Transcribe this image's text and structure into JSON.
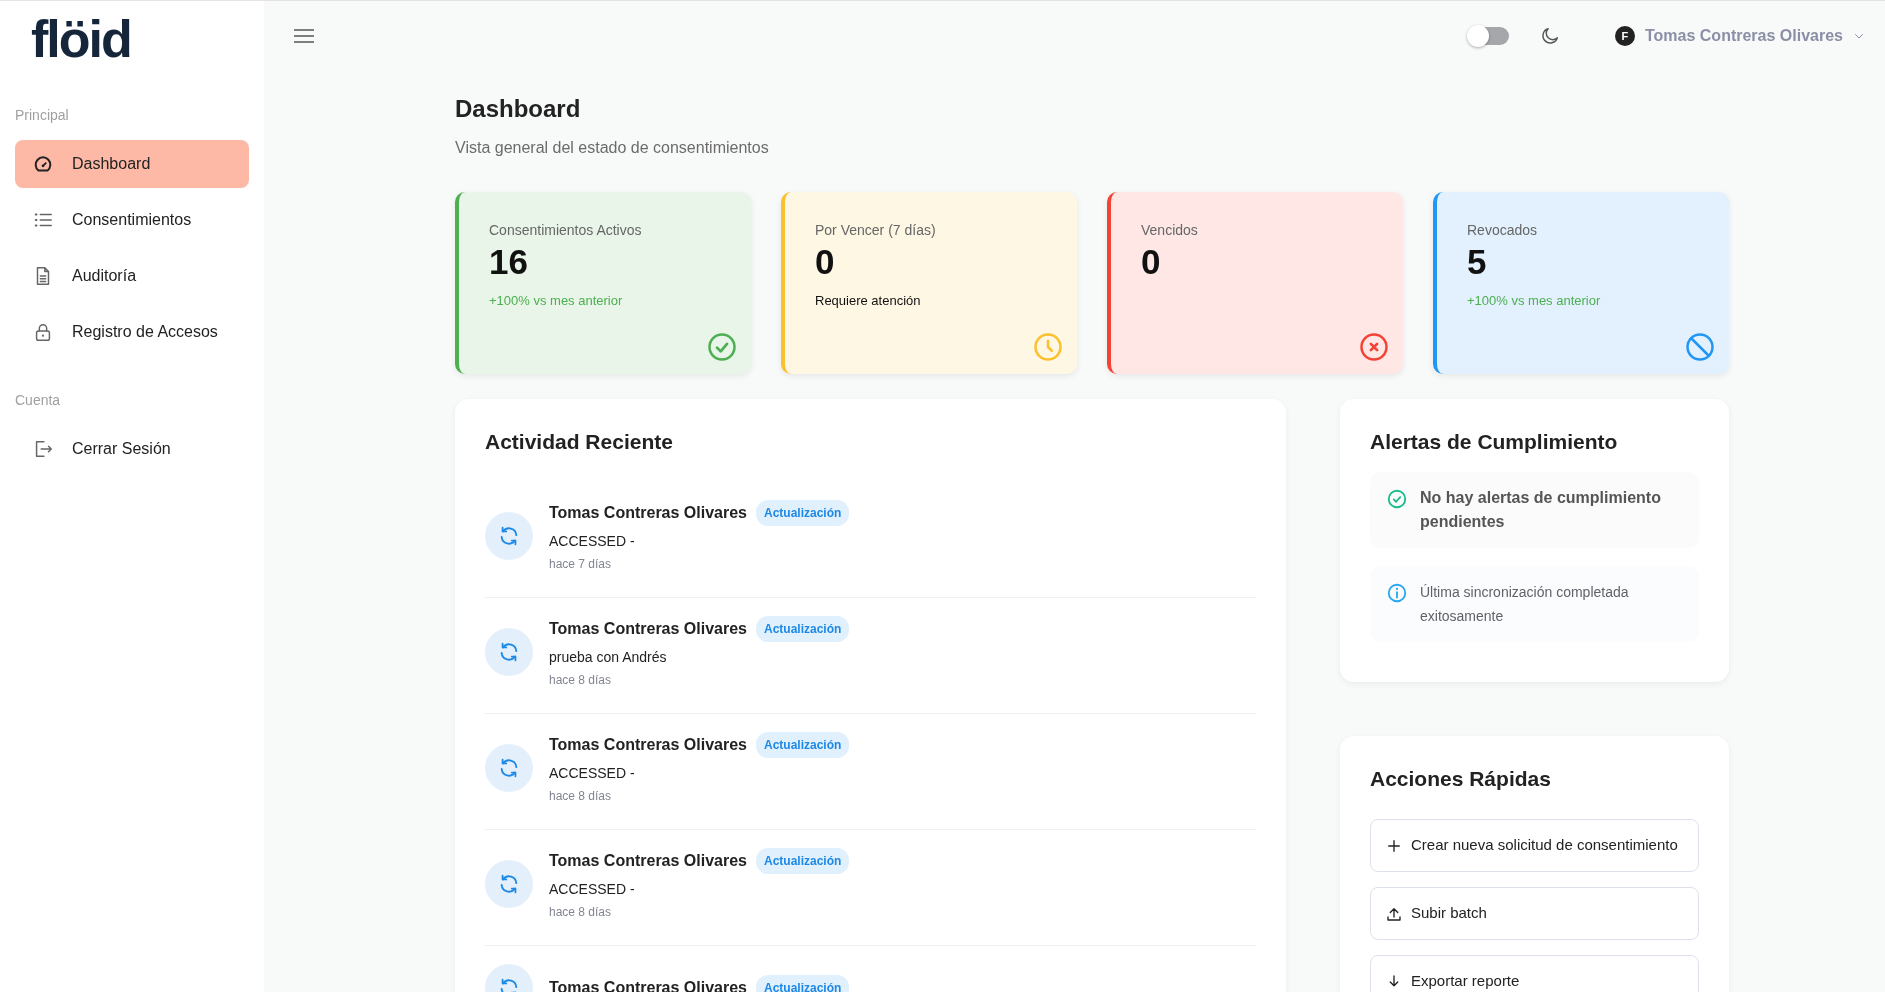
{
  "logo": "flöid",
  "sidebar": {
    "sections": [
      {
        "title": "Principal",
        "items": [
          {
            "label": "Dashboard",
            "kind": "gauge",
            "selected": true
          },
          {
            "label": "Consentimientos",
            "kind": "list",
            "selected": false
          },
          {
            "label": "Auditoría",
            "kind": "document",
            "selected": false
          },
          {
            "label": "Registro de Accesos",
            "kind": "lock",
            "selected": false
          }
        ]
      },
      {
        "title": "Cuenta",
        "items": [
          {
            "label": "Cerrar Sesión",
            "kind": "logout",
            "selected": false
          }
        ]
      }
    ]
  },
  "topbar": {
    "switch_on": false,
    "avatar": "F",
    "user": "Tomas Contreras Olivares"
  },
  "page": {
    "title": "Dashboard",
    "subtitle": "Vista general del estado de consentimientos"
  },
  "stats": [
    {
      "label": "Consentimientos Activos",
      "value": "16",
      "note": "+100% vs mes anterior",
      "kind": "active",
      "color": "#4caf50"
    },
    {
      "label": "Por Vencer (7 días)",
      "value": "0",
      "note": "Requiere atención",
      "kind": "expiring",
      "color": "#fbc02d"
    },
    {
      "label": "Vencidos",
      "value": "0",
      "kind": "expired",
      "color": "#f44336"
    },
    {
      "label": "Revocados",
      "value": "5",
      "note": "+100% vs mes anterior",
      "kind": "revoked",
      "color": "#2196f3"
    }
  ],
  "activity": {
    "title": "Actividad Reciente",
    "items": [
      {
        "name": "Tomas Contreras Olivares",
        "badge": "Actualización",
        "description": "ACCESSED -",
        "time": "hace 7 días"
      },
      {
        "name": "Tomas Contreras Olivares",
        "badge": "Actualización",
        "description": "prueba con Andrés",
        "time": "hace 8 días"
      },
      {
        "name": "Tomas Contreras Olivares",
        "badge": "Actualización",
        "description": "ACCESSED -",
        "time": "hace 8 días"
      },
      {
        "name": "Tomas Contreras Olivares",
        "badge": "Actualización",
        "description": "ACCESSED -",
        "time": "hace 8 días"
      },
      {
        "name": "Tomas Contreras Olivares",
        "badge": "Actualización"
      }
    ]
  },
  "alerts": {
    "title": "Alertas de Cumplimiento",
    "items": [
      {
        "kind": "success",
        "text": "No hay alertas de cumplimiento pendientes"
      },
      {
        "kind": "info",
        "text": "Última sincronización completada exitosamente"
      }
    ]
  },
  "actions": {
    "title": "Acciones Rápidas",
    "items": [
      {
        "kind": "create",
        "label": "Crear nueva solicitud de consentimiento"
      },
      {
        "kind": "upload",
        "label": "Subir batch"
      },
      {
        "kind": "export",
        "label": "Exportar reporte"
      }
    ]
  }
}
